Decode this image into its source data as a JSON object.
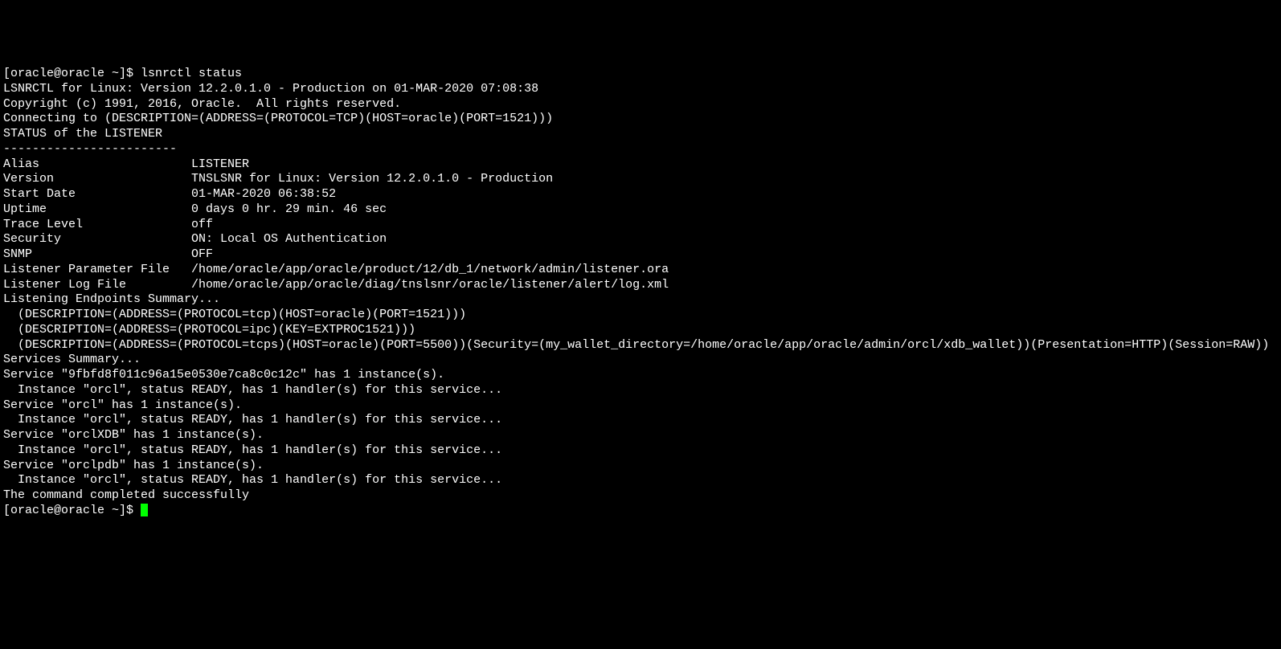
{
  "prompt1": "[oracle@oracle ~]$ ",
  "command": "lsnrctl status",
  "empty": "",
  "banner_line": "LSNRCTL for Linux: Version 12.2.0.1.0 - Production on 01-MAR-2020 07:08:38",
  "copyright": "Copyright (c) 1991, 2016, Oracle.  All rights reserved.",
  "connecting": "Connecting to (DESCRIPTION=(ADDRESS=(PROTOCOL=TCP)(HOST=oracle)(PORT=1521)))",
  "status_header": "STATUS of the LISTENER",
  "separator": "------------------------",
  "alias": "Alias                     LISTENER",
  "version": "Version                   TNSLSNR for Linux: Version 12.2.0.1.0 - Production",
  "start_date": "Start Date                01-MAR-2020 06:38:52",
  "uptime": "Uptime                    0 days 0 hr. 29 min. 46 sec",
  "trace_level": "Trace Level               off",
  "security": "Security                  ON: Local OS Authentication",
  "snmp": "SNMP                      OFF",
  "param_file": "Listener Parameter File   /home/oracle/app/oracle/product/12/db_1/network/admin/listener.ora",
  "log_file": "Listener Log File         /home/oracle/app/oracle/diag/tnslsnr/oracle/listener/alert/log.xml",
  "endpoints_summary": "Listening Endpoints Summary...",
  "endpoint1": "  (DESCRIPTION=(ADDRESS=(PROTOCOL=tcp)(HOST=oracle)(PORT=1521)))",
  "endpoint2": "  (DESCRIPTION=(ADDRESS=(PROTOCOL=ipc)(KEY=EXTPROC1521)))",
  "endpoint3": "  (DESCRIPTION=(ADDRESS=(PROTOCOL=tcps)(HOST=oracle)(PORT=5500))(Security=(my_wallet_directory=/home/oracle/app/oracle/admin/orcl/xdb_wallet))(Presentation=HTTP)(Session=RAW))",
  "services_summary": "Services Summary...",
  "service1": "Service \"9fbfd8f011c96a15e0530e7ca8c0c12c\" has 1 instance(s).",
  "instance1": "  Instance \"orcl\", status READY, has 1 handler(s) for this service...",
  "service2": "Service \"orcl\" has 1 instance(s).",
  "instance2": "  Instance \"orcl\", status READY, has 1 handler(s) for this service...",
  "service3": "Service \"orclXDB\" has 1 instance(s).",
  "instance3": "  Instance \"orcl\", status READY, has 1 handler(s) for this service...",
  "service4": "Service \"orclpdb\" has 1 instance(s).",
  "instance4": "  Instance \"orcl\", status READY, has 1 handler(s) for this service...",
  "completed": "The command completed successfully",
  "prompt2": "[oracle@oracle ~]$ "
}
